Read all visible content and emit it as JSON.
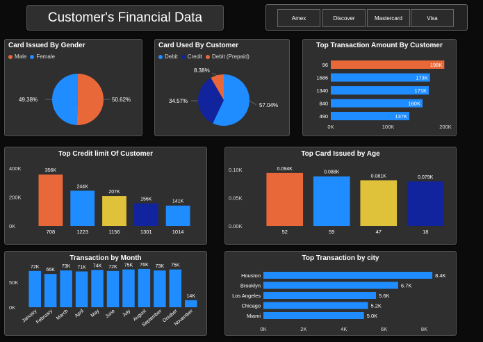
{
  "title": "Customer's Financial Data",
  "slicers": [
    "Amex",
    "Discover",
    "Mastercard",
    "Visa"
  ],
  "colors": {
    "orange": "#e8683a",
    "blue": "#1f8cff",
    "navy": "#12239e",
    "yellow": "#e0c13a",
    "panel": "#2f2f2f",
    "bg": "#0b0b0b"
  },
  "gender": {
    "title": "Card Issued By Gender",
    "legend": [
      {
        "label": "Male",
        "color": "#e8683a"
      },
      {
        "label": "Female",
        "color": "#1f8cff"
      }
    ],
    "labels": {
      "female": "49.38%",
      "male": "50.62%"
    }
  },
  "cardtype": {
    "title": "Card Used By Customer",
    "legend": [
      {
        "label": "Debit",
        "color": "#1f8cff"
      },
      {
        "label": "Credit",
        "color": "#12239e"
      },
      {
        "label": "Debit (Prepaid)",
        "color": "#e8683a"
      }
    ],
    "labels": {
      "prepaid": "8.38%",
      "credit": "34.57%",
      "debit": "57.04%"
    }
  },
  "chart_data": [
    {
      "id": "gender",
      "type": "pie",
      "title": "Card Issued By Gender",
      "categories": [
        "Male",
        "Female"
      ],
      "values": [
        50.62,
        49.38
      ],
      "colors": [
        "#e8683a",
        "#1f8cff"
      ],
      "legend": "top-left"
    },
    {
      "id": "cardtype",
      "type": "pie",
      "title": "Card Used By Customer",
      "categories": [
        "Debit",
        "Credit",
        "Debit (Prepaid)"
      ],
      "values": [
        57.04,
        34.57,
        8.38
      ],
      "colors": [
        "#1f8cff",
        "#12239e",
        "#e8683a"
      ],
      "legend": "top-left"
    },
    {
      "id": "toptxn",
      "type": "bar",
      "orientation": "horizontal",
      "title": "Top Transaction Amount By Customer",
      "categories": [
        "96",
        "1686",
        "1340",
        "840",
        "490"
      ],
      "values": [
        198,
        173,
        171,
        160,
        137
      ],
      "data_labels": [
        "198K",
        "173K",
        "171K",
        "160K",
        "137K"
      ],
      "colors": [
        "#e8683a",
        "#1f8cff",
        "#1f8cff",
        "#1f8cff",
        "#1f8cff"
      ],
      "xticks": [
        "0K",
        "100K",
        "200K"
      ],
      "xlim": [
        0,
        200
      ],
      "unit": "K"
    },
    {
      "id": "credit",
      "type": "bar",
      "title": "Top Credit limit Of Customer",
      "categories": [
        "708",
        "1223",
        "1156",
        "1301",
        "1014"
      ],
      "values": [
        356,
        244,
        207,
        156,
        141
      ],
      "data_labels": [
        "356K",
        "244K",
        "207K",
        "156K",
        "141K"
      ],
      "colors": [
        "#e8683a",
        "#1f8cff",
        "#e0c13a",
        "#12239e",
        "#1f8cff"
      ],
      "yticks": [
        "0K",
        "200K",
        "400K"
      ],
      "ylim": [
        0,
        400
      ],
      "unit": "K"
    },
    {
      "id": "age",
      "type": "bar",
      "title": "Top Card Issued by Age",
      "categories": [
        "52",
        "59",
        "47",
        "18"
      ],
      "values": [
        0.094,
        0.088,
        0.081,
        0.079
      ],
      "data_labels": [
        "0.094K",
        "0.088K",
        "0.081K",
        "0.079K"
      ],
      "colors": [
        "#e8683a",
        "#1f8cff",
        "#e0c13a",
        "#12239e"
      ],
      "yticks": [
        "0.00K",
        "0.05K",
        "0.10K"
      ],
      "ylim": [
        0,
        0.1
      ],
      "unit": "K"
    },
    {
      "id": "month",
      "type": "bar",
      "title": "Transaction by Month",
      "categories": [
        "January",
        "February",
        "March",
        "April",
        "May",
        "June",
        "July",
        "August",
        "September",
        "October",
        "November"
      ],
      "values": [
        72,
        66,
        73,
        71,
        74,
        72,
        75,
        76,
        73,
        75,
        14
      ],
      "data_labels": [
        "72K",
        "66K",
        "73K",
        "71K",
        "74K",
        "72K",
        "75K",
        "76K",
        "73K",
        "75K",
        "14K"
      ],
      "colors": [
        "#1f8cff"
      ],
      "yticks": [
        "0K",
        "50K"
      ],
      "ylim": [
        0,
        80
      ],
      "unit": "K"
    },
    {
      "id": "city",
      "type": "bar",
      "orientation": "horizontal",
      "title": "Top Transaction by city",
      "categories": [
        "Houston",
        "Brooklyn",
        "Los Angeles",
        "Chicago",
        "Miami"
      ],
      "values": [
        8.4,
        6.7,
        5.6,
        5.2,
        5.0
      ],
      "data_labels": [
        "8.4K",
        "6.7K",
        "5.6K",
        "5.2K",
        "5.0K"
      ],
      "colors": [
        "#1f8cff"
      ],
      "xticks": [
        "0K",
        "2K",
        "4K",
        "6K",
        "8K"
      ],
      "xlim": [
        0,
        8.5
      ],
      "unit": "K"
    }
  ]
}
